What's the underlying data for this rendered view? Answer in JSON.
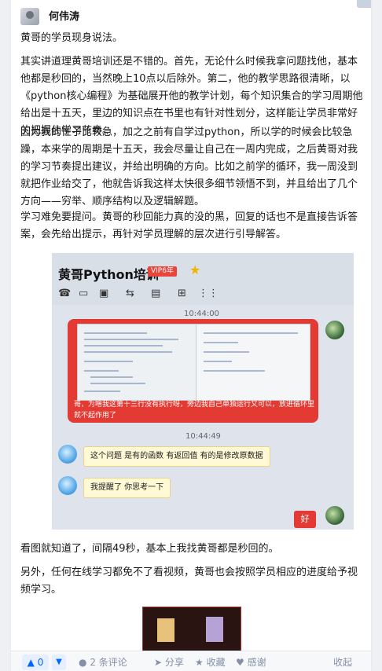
{
  "author": {
    "name": "何伟涛",
    "avatar_icon": "avatar-icon"
  },
  "paragraphs": [
    "黄哥的学员现身说法。",
    "其实讲道理黄哥培训还是不错的。首先，无论什么时候我拿问题找他，基本他都是秒回的，当然晚上10点以后除外。第二，他的教学思路很清晰，以《python核心编程》为基础展开他的教学计划，每个知识集合的学习周期他给出是十五天，里边的知识点在书里也有针对性划分，这样能让学员非常好的把握住学习节奏。",
    "因为我的性子比较急，加之之前有自学过python，所以学的时候会比较急躁，本来学的周期是十五天，我会尽量让自己在一周内完成，之后黄哥对我的学习节奏提出建议，并给出明确的方向。比如之前学的循环，我一周没到就把作业给交了，他就告诉我这样太快很多细节领悟不到，并且给出了几个方向——穷举、顺序结构以及逻辑解题。",
    "学习难免要提问。黄哥的秒回能力真的没的黑，回复的话也不是直接告诉答案，会先给出提示，再针对学员理解的层次进行引导解答。",
    "看图就知道了，间隔49秒，基本上我找黄哥都是秒回的。",
    "另外，任何在线学习都免不了看视频，黄哥也会按照学员相应的进度给予视频学习。"
  ],
  "chat": {
    "title": "黄哥Python培训",
    "vip_badge": "VIP6年",
    "time1": "10:44:00",
    "time2": "10:44:49",
    "red_message": "哥，为啥我这第十三行没有执行呀，旁边我自己单独运行又可以，放进循环里就不起作用了",
    "reply1": "这个问题 是有的函数 有返回值 有的是修改原数据",
    "reply2": "我提醒了 你思考一下",
    "good_label": "好"
  },
  "actions": {
    "upvote_count": "0",
    "comments": "2 条评论",
    "share": "分享",
    "favorite": "收藏",
    "thanks": "感谢",
    "collapse": "收起"
  }
}
